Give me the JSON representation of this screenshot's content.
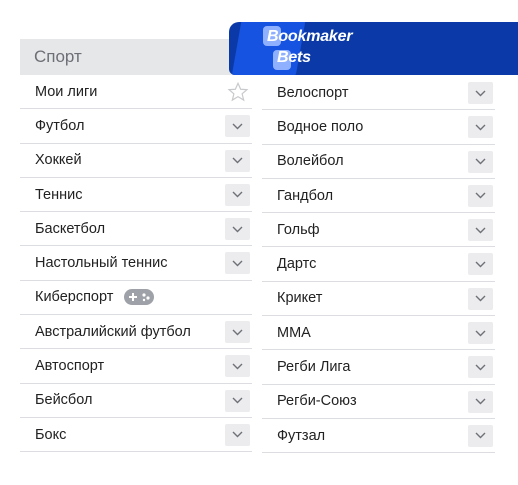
{
  "sidebar": {
    "title": "Спорт",
    "left_items": [
      {
        "label": "Мои лиги",
        "icon": "star-icon"
      },
      {
        "label": "Футбол",
        "icon": "chevron-down-icon"
      },
      {
        "label": "Хоккей",
        "icon": "chevron-down-icon"
      },
      {
        "label": "Теннис",
        "icon": "chevron-down-icon"
      },
      {
        "label": "Баскетбол",
        "icon": "chevron-down-icon"
      },
      {
        "label": "Настольный теннис",
        "icon": "chevron-down-icon"
      },
      {
        "label": "Киберспорт",
        "icon": "gamepad-icon"
      },
      {
        "label": "Австралийский футбол",
        "icon": "chevron-down-icon"
      },
      {
        "label": "Автоспорт",
        "icon": "chevron-down-icon"
      },
      {
        "label": "Бейсбол",
        "icon": "chevron-down-icon"
      },
      {
        "label": "Бокс",
        "icon": "chevron-down-icon"
      }
    ],
    "right_items": [
      {
        "label": "Велоспорт",
        "icon": "chevron-down-icon"
      },
      {
        "label": "Водное поло",
        "icon": "chevron-down-icon"
      },
      {
        "label": "Волейбол",
        "icon": "chevron-down-icon"
      },
      {
        "label": "Гандбол",
        "icon": "chevron-down-icon"
      },
      {
        "label": "Гольф",
        "icon": "chevron-down-icon"
      },
      {
        "label": "Дартс",
        "icon": "chevron-down-icon"
      },
      {
        "label": "Крикет",
        "icon": "chevron-down-icon"
      },
      {
        "label": "ММА",
        "icon": "chevron-down-icon"
      },
      {
        "label": "Регби Лига",
        "icon": "chevron-down-icon"
      },
      {
        "label": "Регби-Союз",
        "icon": "chevron-down-icon"
      },
      {
        "label": "Футзал",
        "icon": "chevron-down-icon"
      }
    ]
  },
  "logo": {
    "line1": "Bookmaker",
    "line2": "Bets"
  },
  "colors": {
    "brand_dark": "#0b3aa8",
    "brand_light": "#1553e0",
    "header_bg": "#e6e7e9",
    "chevron_bg": "#ececee"
  }
}
